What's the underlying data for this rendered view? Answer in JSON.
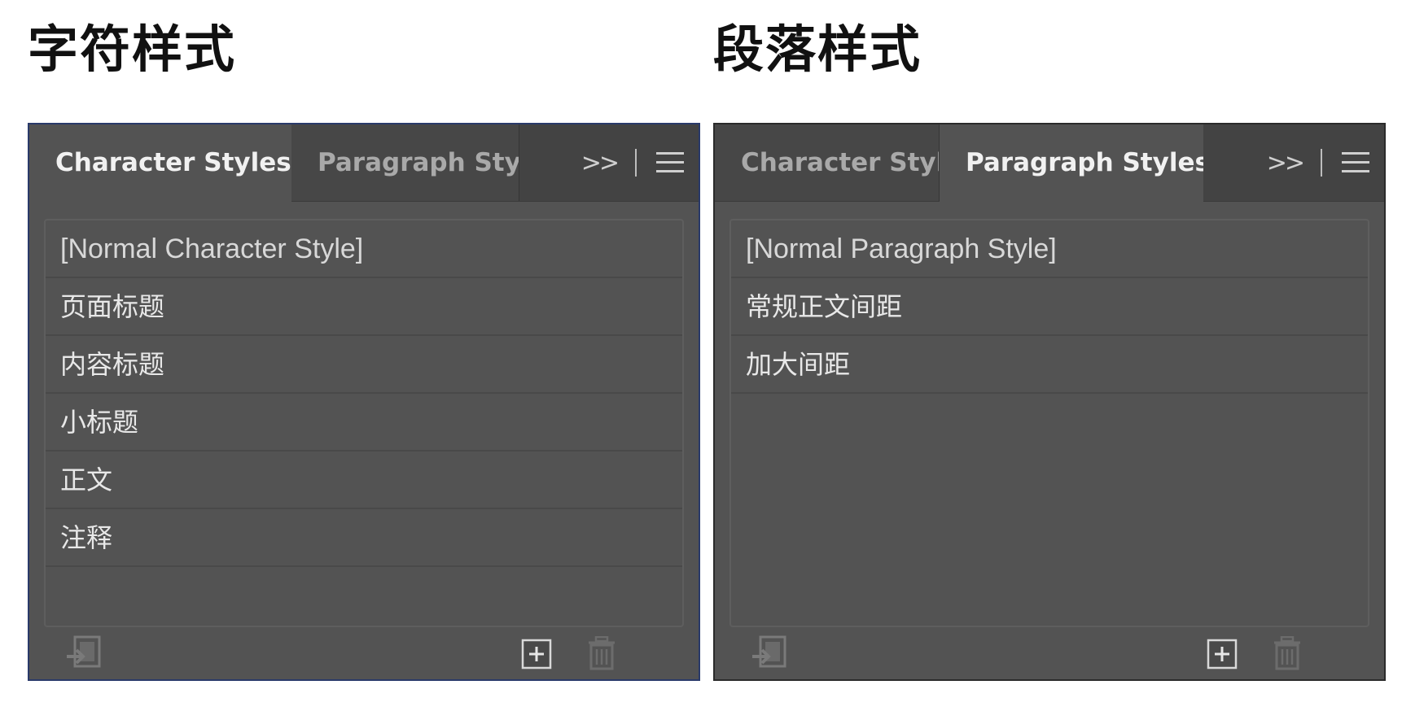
{
  "headings": {
    "left": "字符样式",
    "right": "段落样式"
  },
  "panels": [
    {
      "tabs": [
        {
          "label": "Character Styles",
          "active": true
        },
        {
          "label": "Paragraph Styles",
          "active": false
        }
      ],
      "overflow_label": ">>",
      "items": [
        {
          "label": "[Normal Character Style]"
        },
        {
          "label": "页面标题"
        },
        {
          "label": "内容标题"
        },
        {
          "label": "小标题"
        },
        {
          "label": "正文"
        },
        {
          "label": "注释"
        }
      ],
      "icons": [
        "load-styles-icon",
        "new-style-icon",
        "delete-style-icon",
        "panel-menu-icon"
      ]
    },
    {
      "tabs": [
        {
          "label": "Character Styles",
          "active": false
        },
        {
          "label": "Paragraph Styles",
          "active": true
        }
      ],
      "overflow_label": ">>",
      "items": [
        {
          "label": "[Normal Paragraph Style]"
        },
        {
          "label": "常规正文间距"
        },
        {
          "label": "加大间距"
        }
      ],
      "icons": [
        "load-styles-icon",
        "new-style-icon",
        "delete-style-icon",
        "panel-menu-icon"
      ]
    }
  ],
  "colors": {
    "panel_bg": "#535353",
    "tabbar_bg": "#434343",
    "text": "#e8e8e8",
    "inactive_text": "#a9a9a9"
  }
}
